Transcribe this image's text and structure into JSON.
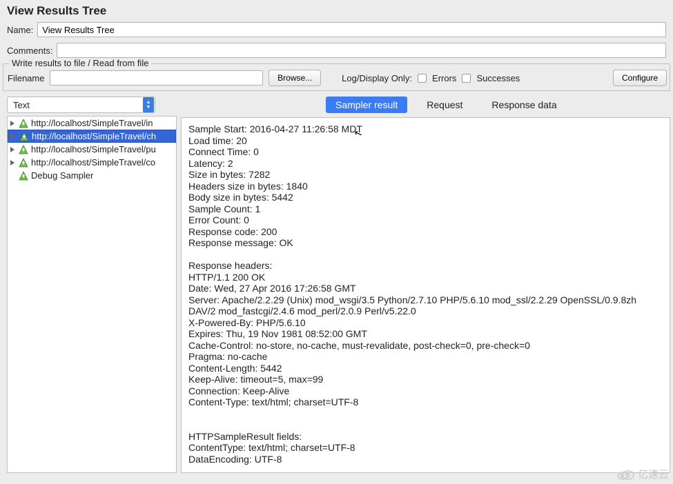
{
  "title": "View Results Tree",
  "fields": {
    "name_label": "Name:",
    "name_value": "View Results Tree",
    "comments_label": "Comments:",
    "comments_value": ""
  },
  "file_section": {
    "legend": "Write results to file / Read from file",
    "filename_label": "Filename",
    "filename_value": "",
    "browse_label": "Browse...",
    "logdisplay_label": "Log/Display Only:",
    "errors_label": "Errors",
    "successes_label": "Successes",
    "configure_label": "Configure"
  },
  "renderer_combo": "Text",
  "tree": [
    {
      "label": "http://localhost/SimpleTravel/in",
      "expandable": true
    },
    {
      "label": "http://localhost/SimpleTravel/ch",
      "expandable": true,
      "selected": true
    },
    {
      "label": "http://localhost/SimpleTravel/pu",
      "expandable": true
    },
    {
      "label": "http://localhost/SimpleTravel/co",
      "expandable": true
    },
    {
      "label": "Debug Sampler",
      "expandable": false
    }
  ],
  "tabs": {
    "sampler": "Sampler result",
    "request": "Request",
    "response": "Response data"
  },
  "result_text": "Sample Start: 2016-04-27 11:26:58 MDT\nLoad time: 20\nConnect Time: 0\nLatency: 2\nSize in bytes: 7282\nHeaders size in bytes: 1840\nBody size in bytes: 5442\nSample Count: 1\nError Count: 0\nResponse code: 200\nResponse message: OK\n\nResponse headers:\nHTTP/1.1 200 OK\nDate: Wed, 27 Apr 2016 17:26:58 GMT\nServer: Apache/2.2.29 (Unix) mod_wsgi/3.5 Python/2.7.10 PHP/5.6.10 mod_ssl/2.2.29 OpenSSL/0.9.8zh DAV/2 mod_fastcgi/2.4.6 mod_perl/2.0.9 Perl/v5.22.0\nX-Powered-By: PHP/5.6.10\nExpires: Thu, 19 Nov 1981 08:52:00 GMT\nCache-Control: no-store, no-cache, must-revalidate, post-check=0, pre-check=0\nPragma: no-cache\nContent-Length: 5442\nKeep-Alive: timeout=5, max=99\nConnection: Keep-Alive\nContent-Type: text/html; charset=UTF-8\n\n\nHTTPSampleResult fields:\nContentType: text/html; charset=UTF-8\nDataEncoding: UTF-8",
  "watermark": "亿速云"
}
